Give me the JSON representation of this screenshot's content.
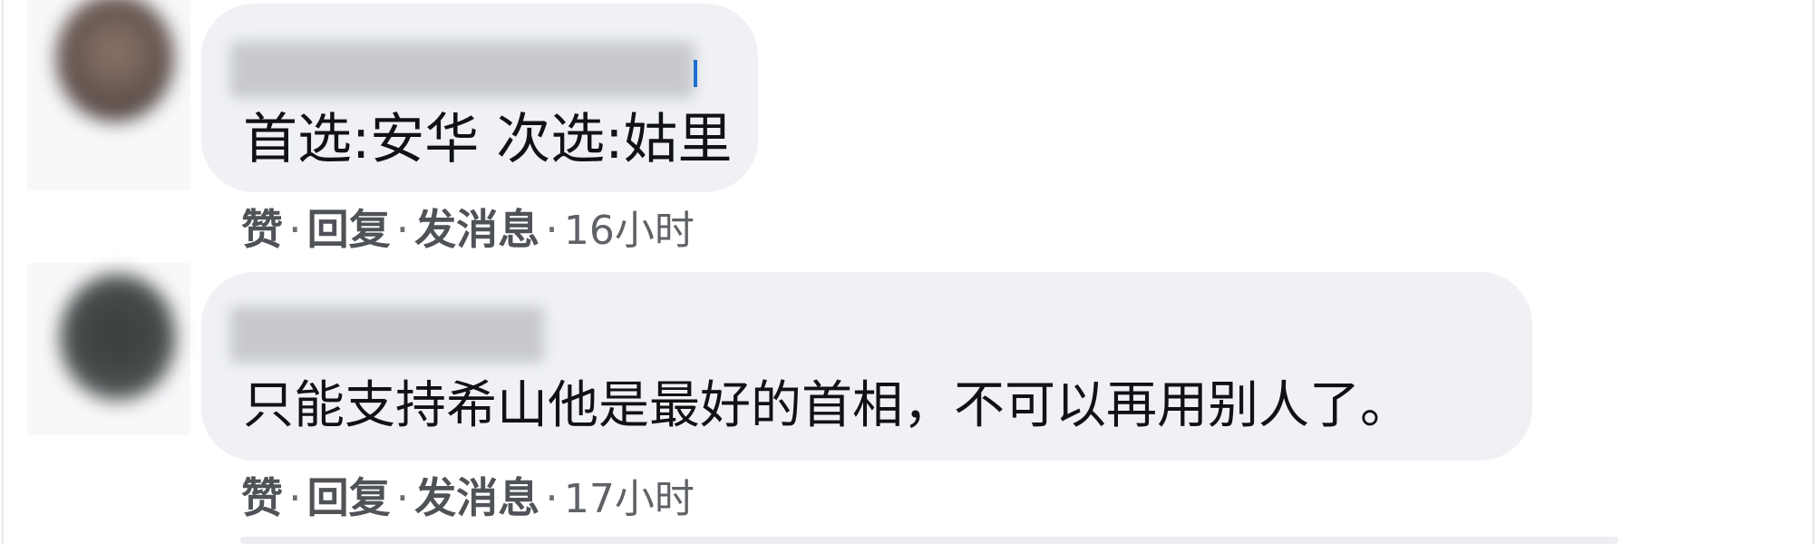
{
  "comments": [
    {
      "text": "首选:安华 次选:姑里",
      "actions": {
        "like": "赞",
        "reply": "回复",
        "message": "发消息",
        "separator": "·",
        "time": "16小时"
      }
    },
    {
      "text": "只能支持希山他是最好的首相，不可以再用别人了。",
      "actions": {
        "like": "赞",
        "reply": "回复",
        "message": "发消息",
        "separator": "·",
        "time": "17小时"
      }
    }
  ],
  "colors": {
    "bubble_bg": "#eff1f5",
    "text": "#111214",
    "meta": "#5a5c60"
  },
  "icons": [
    "avatar-blurred",
    "username-blurred"
  ]
}
